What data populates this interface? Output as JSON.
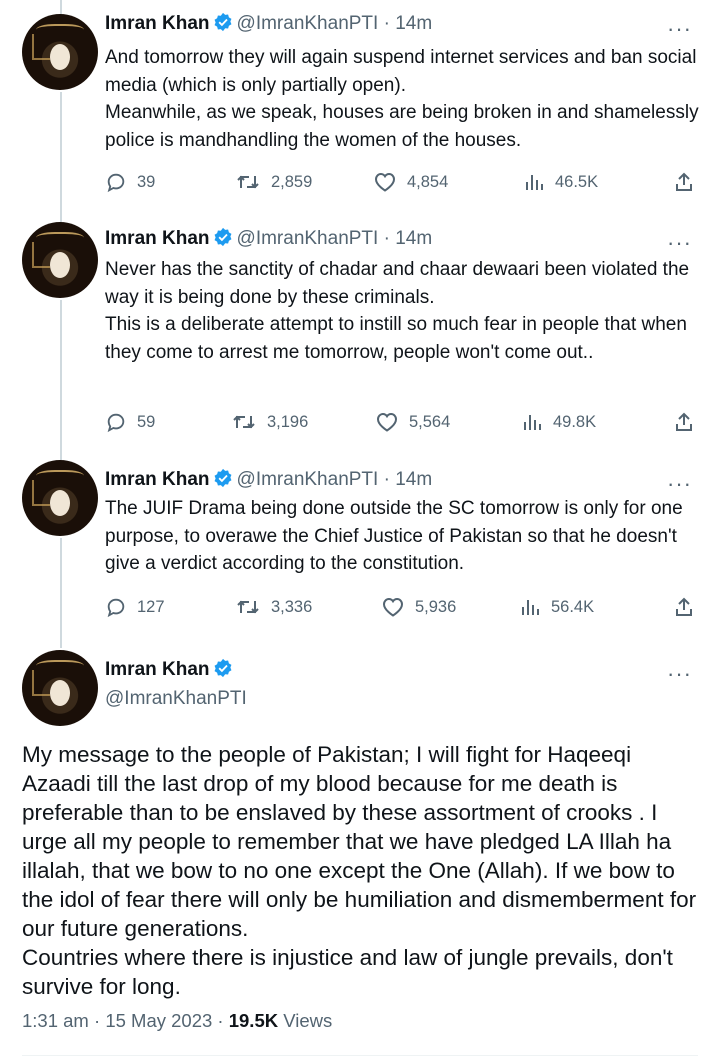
{
  "tweets": [
    {
      "name": "Imran Khan",
      "handle": "@ImranKhanPTI",
      "sep": "·",
      "time": "14m",
      "text": "And tomorrow they will again suspend internet services and ban social media (which is only partially open).\nMeanwhile, as we speak, houses are being broken in and shamelessly police is mandhandling the women of the houses.",
      "replies": "39",
      "retweets": "2,859",
      "likes": "4,854",
      "views": "46.5K"
    },
    {
      "name": "Imran Khan",
      "handle": "@ImranKhanPTI",
      "sep": "·",
      "time": "14m",
      "text": "Never has the sanctity of chadar and chaar dewaari been violated the way it is being done by these criminals.\nThis is a deliberate attempt to instill so much fear in people that when they come to arrest me tomorrow, people won't come out..",
      "replies": "59",
      "retweets": "3,196",
      "likes": "5,564",
      "views": "49.8K"
    },
    {
      "name": "Imran Khan",
      "handle": "@ImranKhanPTI",
      "sep": "·",
      "time": "14m",
      "text": "The JUIF Drama being done outside the SC tomorrow is only for one purpose, to overawe the Chief Justice of Pakistan so that he doesn't give a verdict according to the constitution.",
      "replies": "127",
      "retweets": "3,336",
      "likes": "5,936",
      "views": "56.4K"
    }
  ],
  "main_tweet": {
    "name": "Imran Khan",
    "handle": "@ImranKhanPTI",
    "text": "My message to the people of Pakistan; I will fight for Haqeeqi Azaadi till the last drop of my blood because for me death is preferable than to be enslaved by these assortment of crooks . I urge all my people to remember that we have pledged LA Illah ha illalah, that we bow to no one except the One (Allah). If we bow to the idol of fear there will only be humiliation and dismemberment for our future generations.\nCountries where there is injustice and law of jungle prevails, don't survive for long.",
    "time": "1:31 am",
    "sep1": "·",
    "date": "15 May 2023",
    "sep2": "·",
    "views_count": "19.5K",
    "views_label": "Views"
  },
  "more_symbol": "···",
  "colors": {
    "text": "#0f1419",
    "secondary": "#536471",
    "verified": "#1d9bf0",
    "thread_line": "#cfd9de"
  },
  "icons": [
    "verified-badge-icon",
    "reply-icon",
    "retweet-icon",
    "like-icon",
    "views-icon",
    "share-icon",
    "more-icon"
  ]
}
